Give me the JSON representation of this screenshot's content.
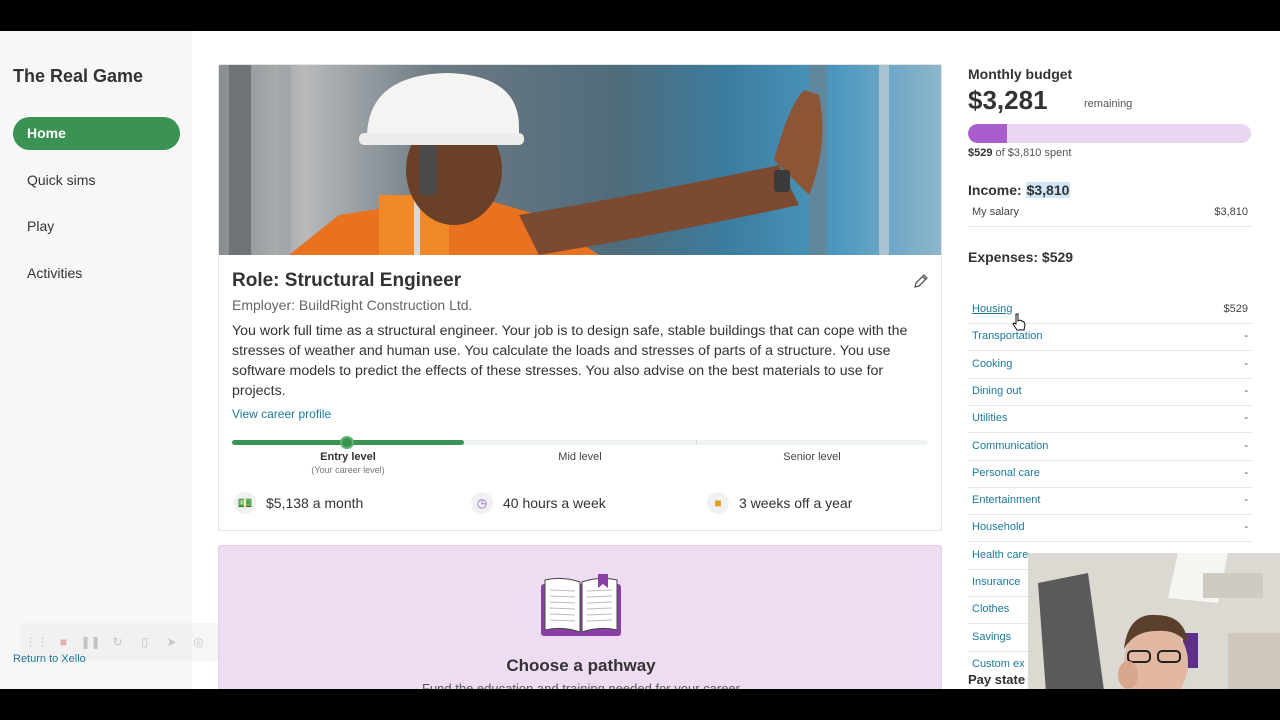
{
  "sidebar": {
    "title": "The Real Game",
    "items": [
      {
        "label": "Home",
        "active": true
      },
      {
        "label": "Quick sims",
        "active": false
      },
      {
        "label": "Play",
        "active": false
      },
      {
        "label": "Activities",
        "active": false
      }
    ],
    "return_link": "Return to Xello"
  },
  "role": {
    "title": "Role: Structural Engineer",
    "employer": "Employer: BuildRight Construction Ltd.",
    "description": "You work full time as a structural engineer. Your job is to design safe, stable buildings that can cope with the stresses of weather and human use. You calculate the loads and stresses of parts of a structure. You use software models to predict the effects of these stresses. You also advise on the best materials to use for projects.",
    "profile_link": "View career profile",
    "levels": [
      {
        "label": "Entry level",
        "sub": "(Your career level)",
        "current": true
      },
      {
        "label": "Mid level",
        "current": false
      },
      {
        "label": "Senior level",
        "current": false
      }
    ],
    "stats": {
      "salary": "$5,138 a month",
      "hours": "40 hours a week",
      "vacation": "3 weeks off a year"
    }
  },
  "pathway": {
    "title": "Choose a pathway",
    "subtitle": "Fund the education and training needed for your career"
  },
  "budget": {
    "label": "Monthly budget",
    "remaining_amount": "$3,281",
    "remaining_label": "remaining",
    "spent_fraction": 0.139,
    "spent_amount": "$529",
    "spent_suffix": "of $3,810 spent",
    "income_label": "Income:",
    "income_amount": "$3,810",
    "income_rows": [
      {
        "name": "My salary",
        "value": "$3,810"
      }
    ],
    "expenses_label": "Expenses: $529",
    "expense_rows": [
      {
        "name": "Housing",
        "value": "$529"
      },
      {
        "name": "Transportation",
        "value": "-"
      },
      {
        "name": "Cooking",
        "value": "-"
      },
      {
        "name": "Dining out",
        "value": "-"
      },
      {
        "name": "Utilities",
        "value": "-"
      },
      {
        "name": "Communication",
        "value": "-"
      },
      {
        "name": "Personal care",
        "value": "-"
      },
      {
        "name": "Entertainment",
        "value": "-"
      },
      {
        "name": "Household",
        "value": "-"
      },
      {
        "name": "Health care",
        "value": "-"
      },
      {
        "name": "Insurance",
        "value": "-"
      },
      {
        "name": "Clothes",
        "value": "-"
      },
      {
        "name": "Savings",
        "value": "-"
      },
      {
        "name": "Custom ex",
        "value": "-"
      }
    ],
    "pay_statement": "Pay state"
  },
  "colors": {
    "accent_green": "#3a9352",
    "budget_purple": "#a95ccc",
    "link_blue": "#1a7a9a"
  }
}
